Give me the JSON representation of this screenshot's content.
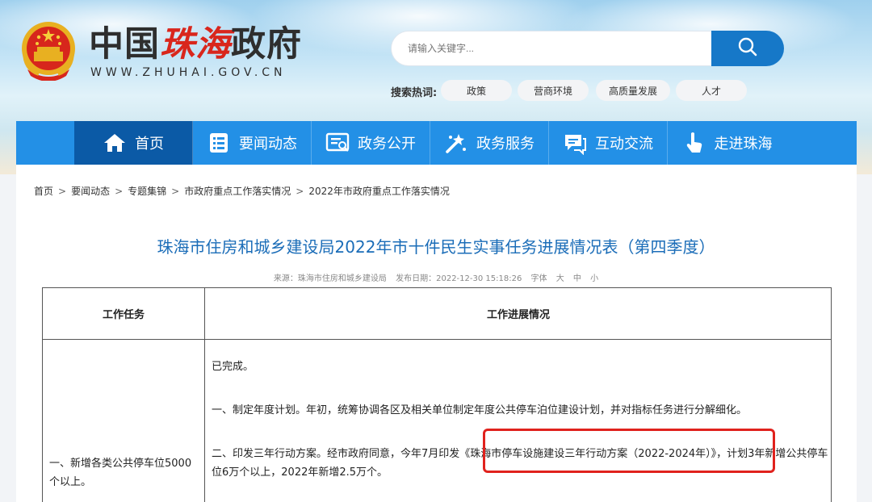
{
  "site": {
    "logo_part1": "中国",
    "logo_part2": "珠海",
    "logo_part3": "政府",
    "url": "WWW.ZHUHAI.GOV.CN"
  },
  "search": {
    "placeholder": "请输入关键字..."
  },
  "hot_search": {
    "label": "搜索热词:",
    "tags": [
      "政策",
      "营商环境",
      "高质量发展",
      "人才"
    ]
  },
  "nav": {
    "items": [
      {
        "label": "首页",
        "icon": "home-icon"
      },
      {
        "label": "要闻动态",
        "icon": "news-list-icon"
      },
      {
        "label": "政务公开",
        "icon": "document-icon"
      },
      {
        "label": "政务服务",
        "icon": "tools-icon"
      },
      {
        "label": "互动交流",
        "icon": "chat-icon"
      },
      {
        "label": "走进珠海",
        "icon": "hand-pointer-icon"
      }
    ]
  },
  "breadcrumb": [
    "首页",
    "要闻动态",
    "专题集锦",
    "市政府重点工作落实情况",
    "2022年市政府重点工作落实情况"
  ],
  "article": {
    "title": "珠海市住房和城乡建设局2022年市十件民生实事任务进展情况表（第四季度）",
    "source": "来源：珠海市住房和城乡建设局",
    "date": "发布日期：2022-12-30 15:18:26",
    "font_label": "字体",
    "font_large": "大",
    "font_medium": "中",
    "font_small": "小"
  },
  "table": {
    "headers": [
      "工作任务",
      "工作进展情况"
    ],
    "task": "一、新增各类公共停车位5000个以上。",
    "progress": [
      "已完成。",
      "一、制定年度计划。年初，统筹协调各区及相关单位制定年度公共停车泊位建设计划，并对指标任务进行分解细化。",
      "二、印发三年行动方案。经市政府同意，今年7月印发《珠海市停车设施建设三年行动方案（2022-2024年）》，计划3年新增公共停车位6万个以上，2022年新增2.5万个。"
    ]
  },
  "colors": {
    "nav_bg": "#2390e6",
    "nav_active": "#0b5aa6",
    "title_blue": "#1b6db8",
    "highlight_red": "#e0221d",
    "search_btn": "#1678c8"
  }
}
